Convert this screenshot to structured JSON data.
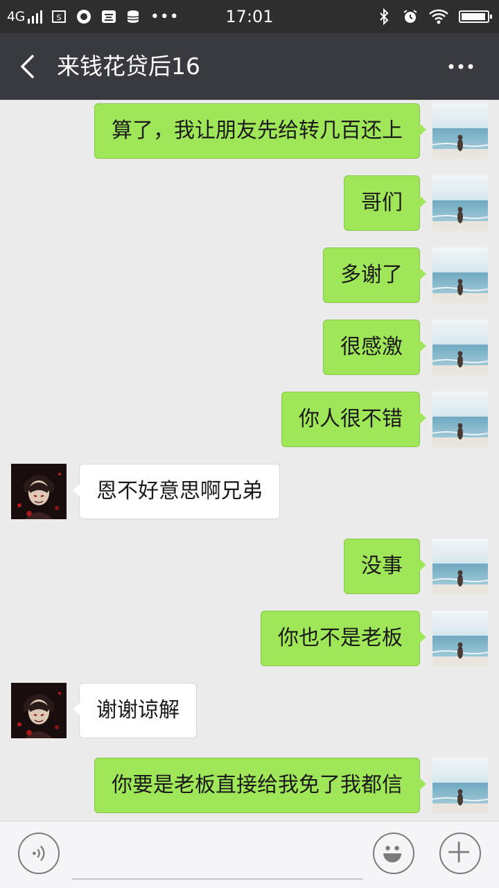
{
  "status_bar": {
    "network": "4G",
    "time": "17:01",
    "battery_level": 0.95,
    "icons": [
      "signal-icon",
      "screenshot-icon",
      "app-icon",
      "app-icon",
      "database-icon",
      "more-dots-icon",
      "bluetooth-icon",
      "alarm-icon",
      "wifi-icon",
      "battery-icon"
    ]
  },
  "header": {
    "title": "来钱花贷后16",
    "back_icon": "chevron-left-icon",
    "more_icon": "more-dots-icon"
  },
  "messages": [
    {
      "side": "sent",
      "text": "算了，我让朋友先给转几百还上"
    },
    {
      "side": "sent",
      "text": "哥们"
    },
    {
      "side": "sent",
      "text": "多谢了"
    },
    {
      "side": "sent",
      "text": "很感激"
    },
    {
      "side": "sent",
      "text": "你人很不错"
    },
    {
      "side": "recv",
      "text": "恩不好意思啊兄弟"
    },
    {
      "side": "sent",
      "text": "没事"
    },
    {
      "side": "sent",
      "text": "你也不是老板"
    },
    {
      "side": "recv",
      "text": "谢谢谅解"
    },
    {
      "side": "sent",
      "text": "你要是老板直接给我免了我都信"
    }
  ],
  "input_bar": {
    "value": "",
    "voice_icon": "voice-icon",
    "emoji_icon": "emoji-icon",
    "plus_icon": "plus-icon"
  },
  "colors": {
    "sent_bubble": "#9fe658",
    "recv_bubble": "#ffffff",
    "nav_bg": "#393a3f",
    "status_bg": "#2e2e2e",
    "chat_bg": "#ebebeb"
  }
}
